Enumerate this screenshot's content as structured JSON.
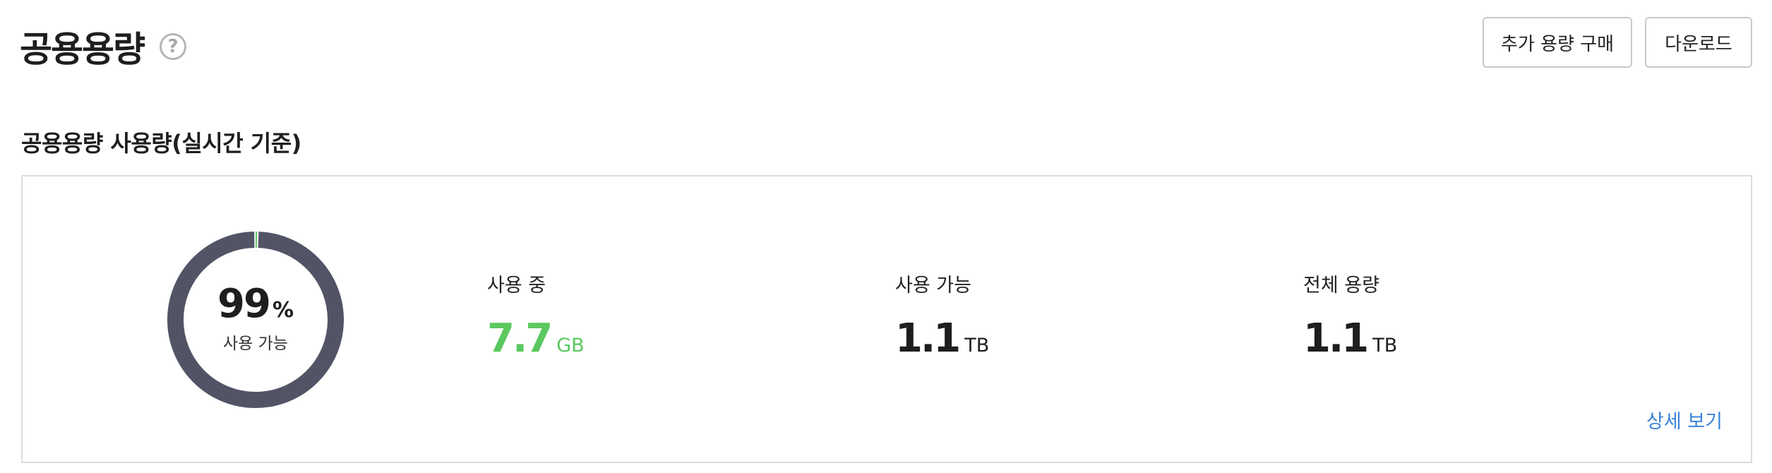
{
  "header": {
    "title": "공용용량",
    "help_icon": "question-mark-circle-icon",
    "actions": {
      "buy_label": "추가 용량 구매",
      "download_label": "다운로드"
    }
  },
  "section": {
    "title": "공용용량 사용량(실시간 기준)"
  },
  "usage": {
    "donut": {
      "percent": "99",
      "percent_unit": "%",
      "label": "사용 가능",
      "available_fraction": 0.993,
      "colors": {
        "available": "#525466",
        "used": "#5ac85f",
        "gap": "#ffffff"
      }
    },
    "used": {
      "label": "사용 중",
      "value": "7.7",
      "unit": "GB",
      "color": "#5ac85f"
    },
    "available": {
      "label": "사용 가능",
      "value": "1.1",
      "unit": "TB"
    },
    "total": {
      "label": "전체 용량",
      "value": "1.1",
      "unit": "TB"
    },
    "detail_link": "상세 보기",
    "link_color": "#3a82d8"
  }
}
